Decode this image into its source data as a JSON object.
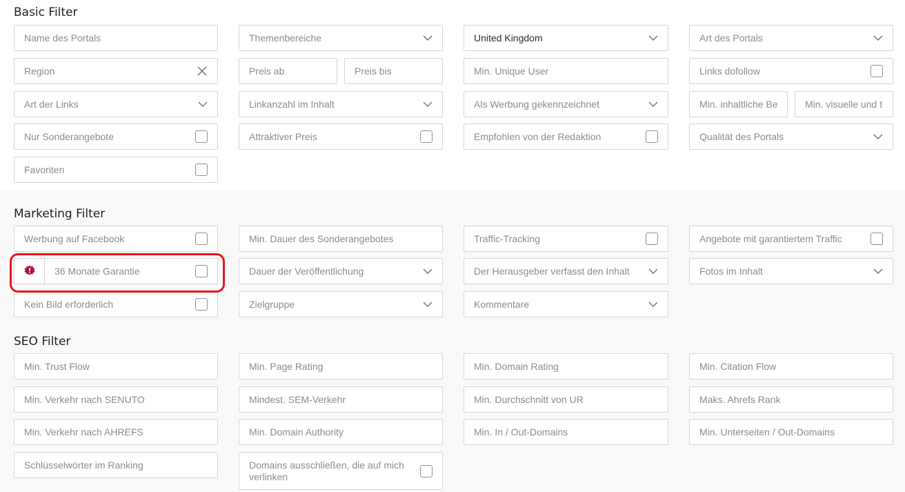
{
  "basic": {
    "title": "Basic Filter",
    "fields": {
      "name_portal": "Name des Portals",
      "themen": "Themenbereiche",
      "country": "United Kingdom",
      "art_portal": "Art des Portals",
      "region": "Region",
      "preis_ab": "Preis ab",
      "preis_bis": "Preis bis",
      "min_unique": "Min. Unique User",
      "links_dofollow": "Links dofollow",
      "art_links": "Art der Links",
      "linkanzahl": "Linkanzahl im Inhalt",
      "als_werbung": "Als Werbung gekennzeichnet",
      "min_inhaltliche": "Min. inhaltliche Bewertung",
      "min_visuelle": "Min. visuelle und technische Bewertung",
      "nur_sonder": "Nur Sonderangebote",
      "attraktiver": "Attraktiver Preis",
      "empfohlen": "Empfohlen von der Redaktion",
      "qualitaet": "Qualität des Portals",
      "favoriten": "Favoriten"
    }
  },
  "marketing": {
    "title": "Marketing Filter",
    "fields": {
      "werbung_fb": "Werbung auf Facebook",
      "min_dauer_sonder": "Min. Dauer des Sonderangebotes",
      "traffic_tracking": "Traffic-Tracking",
      "garantierter_traffic": "Angebote mit garantiertem Traffic",
      "garantie36": "36 Monate Garantie",
      "dauer_veroeff": "Dauer der Veröffentlichung",
      "herausgeber": "Der Herausgeber verfasst den Inhalt",
      "fotos": "Fotos im Inhalt",
      "kein_bild": "Kein Bild erforderlich",
      "zielgruppe": "Zielgruppe",
      "kommentare": "Kommentare"
    }
  },
  "seo": {
    "title": "SEO Filter",
    "fields": {
      "trust_flow": "Min. Trust Flow",
      "page_rating": "Min. Page Rating",
      "domain_rating": "Min. Domain Rating",
      "citation_flow": "Min. Citation Flow",
      "senuto": "Min. Verkehr nach SENUTO",
      "sem": "Mindest. SEM-Verkehr",
      "ur": "Min. Durchschnitt von UR",
      "ahrefs_rank": "Maks. Ahrefs Rank",
      "ahrefs_traffic": "Min. Verkehr nach AHREFS",
      "domain_authority": "Min. Domain Authority",
      "in_out": "Min. In / Out-Domains",
      "unterseiten": "Min. Unterseiten / Out-Domains",
      "keywords": "Schlüsselwörter im Ranking",
      "ausschliessen": "Domains ausschließen, die auf mich verlinken"
    }
  },
  "colors": {
    "highlight": "#e8141c",
    "badge": "#b0123a",
    "border": "#d5d5d9"
  },
  "icons": {
    "dropdown": "chevron-down-icon",
    "clear": "close-icon",
    "badge": "certificate-badge-icon"
  }
}
